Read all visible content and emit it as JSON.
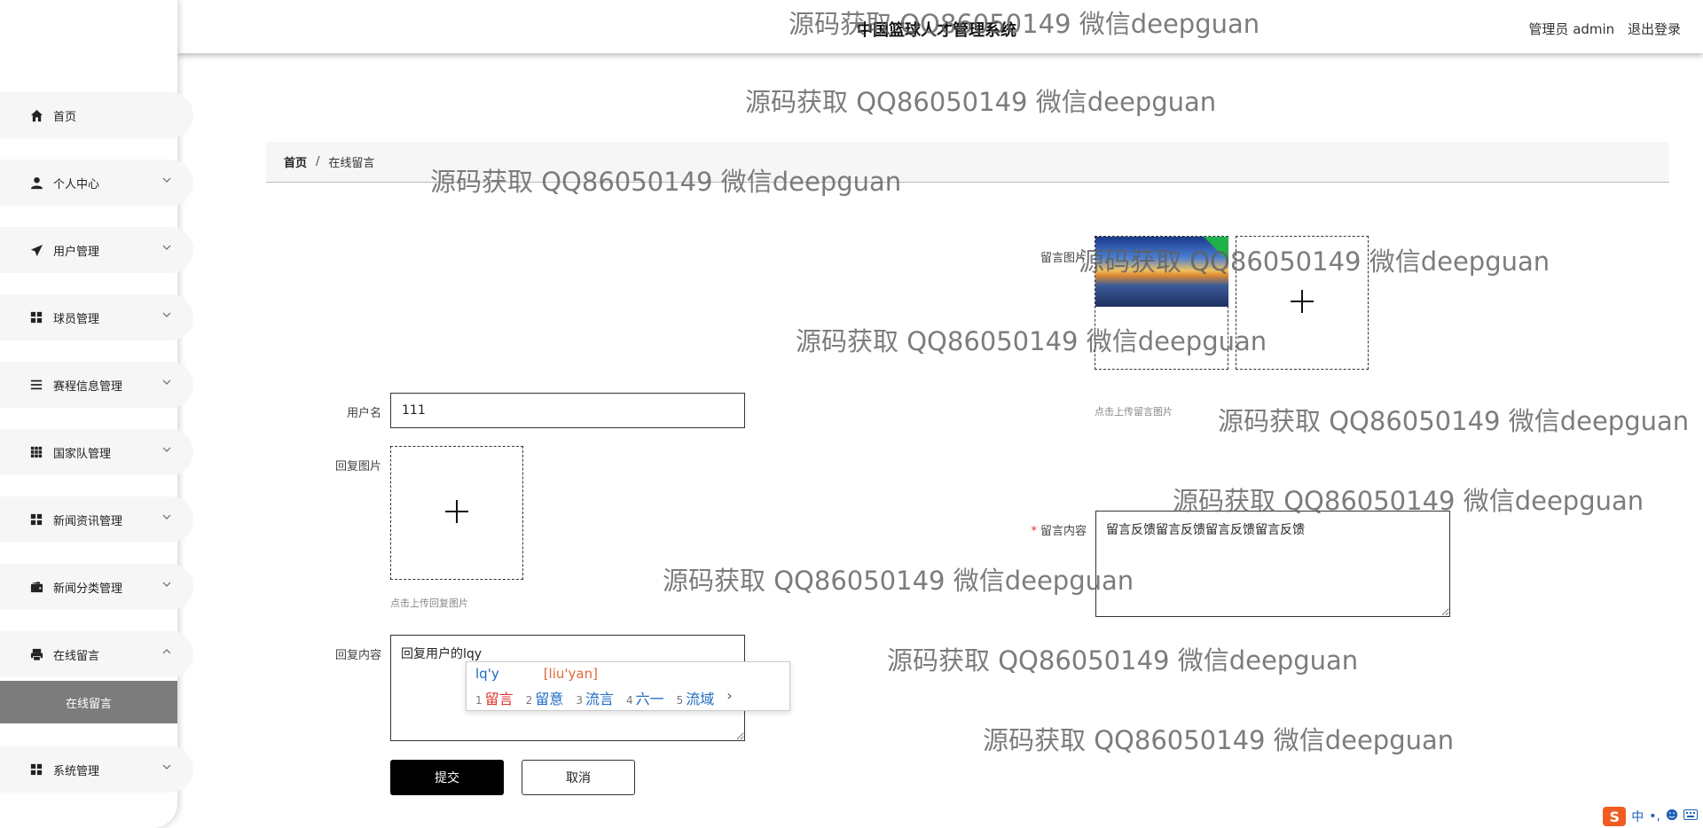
{
  "sidebar": {
    "items": [
      {
        "label": "首页",
        "icon": "home-icon"
      },
      {
        "label": "个人中心",
        "icon": "user-icon"
      },
      {
        "label": "用户管理",
        "icon": "send-icon"
      },
      {
        "label": "球员管理",
        "icon": "grid-icon"
      },
      {
        "label": "赛程信息管理",
        "icon": "list-icon"
      },
      {
        "label": "国家队管理",
        "icon": "apps-icon"
      },
      {
        "label": "新闻资讯管理",
        "icon": "grid-icon"
      },
      {
        "label": "新闻分类管理",
        "icon": "wallet-icon"
      },
      {
        "label": "在线留言",
        "icon": "printer-icon"
      },
      {
        "label": "系统管理",
        "icon": "grid-icon"
      }
    ],
    "sub_item": "在线留言"
  },
  "header": {
    "title": "中国篮球人才管理系统",
    "user": "管理员 admin",
    "logout": "退出登录"
  },
  "breadcrumb": {
    "home": "首页",
    "sep": "/",
    "current": "在线留言"
  },
  "form": {
    "username_label": "用户名",
    "username_value": "111",
    "reply_image_label": "回复图片",
    "reply_image_hint": "点击上传回复图片",
    "reply_content_label": "回复内容",
    "reply_content_value": "回复用户的lqy",
    "message_image_label": "留言图片",
    "message_image_hint": "点击上传留言图片",
    "message_content_required": "*",
    "message_content_label": "留言内容",
    "message_content_value": "留言反馈留言反馈留言反馈留言反馈",
    "submit_label": "提交",
    "cancel_label": "取消"
  },
  "ime": {
    "input": "lq'y",
    "pinyin": "[liu'yan]",
    "candidates": [
      {
        "num": "1",
        "text": "留言"
      },
      {
        "num": "2",
        "text": "留意"
      },
      {
        "num": "3",
        "text": "流言"
      },
      {
        "num": "4",
        "text": "六一"
      },
      {
        "num": "5",
        "text": "流域"
      }
    ],
    "next": "›"
  },
  "tray": {
    "logo": "S",
    "mode": "中",
    "punct": "•,"
  },
  "watermark": "源码获取 QQ86050149 微信deepguan"
}
